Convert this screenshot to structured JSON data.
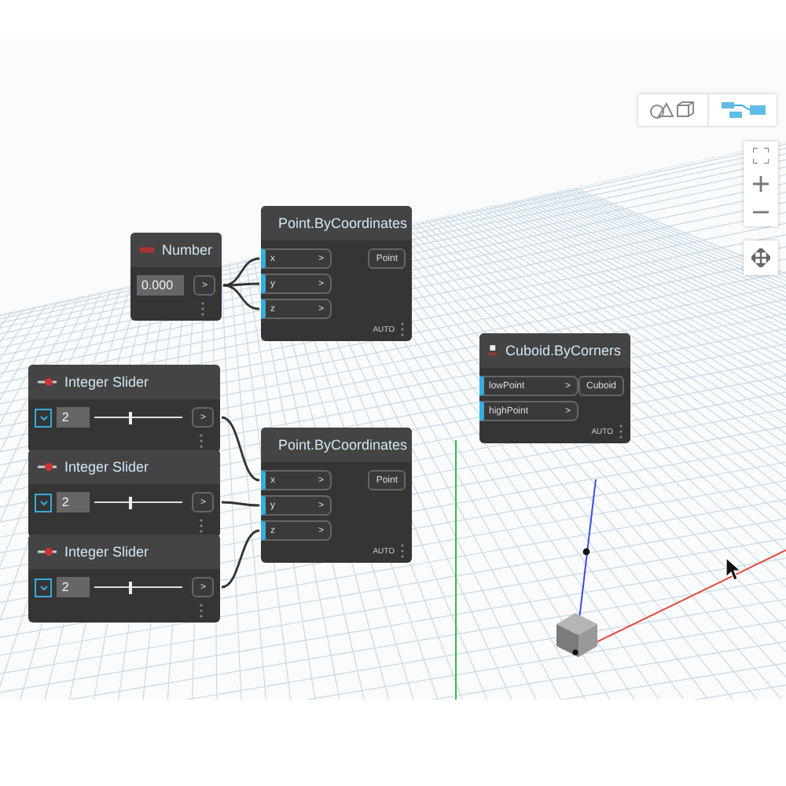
{
  "view_toggle": [
    {
      "kind": "geometry",
      "selected": false
    },
    {
      "kind": "graph",
      "selected": true
    }
  ],
  "nodes": [
    {
      "kind": "number",
      "title": "Number",
      "value": "0.000",
      "output": ">"
    },
    {
      "kind": "function",
      "title": "Point.ByCoordinates",
      "inputs": [
        "x",
        "y",
        "z"
      ],
      "port_arrow": ">",
      "output": "Point",
      "lacing": "AUTO"
    },
    {
      "kind": "slider",
      "title": "Integer Slider",
      "value": "2",
      "level": 0.4,
      "output": ">"
    },
    {
      "kind": "slider",
      "title": "Integer Slider",
      "value": "2",
      "level": 0.4,
      "output": ">"
    },
    {
      "kind": "slider",
      "title": "Integer Slider",
      "value": "2",
      "level": 0.4,
      "output": ">"
    },
    {
      "kind": "function",
      "title": "Point.ByCoordinates",
      "inputs": [
        "x",
        "y",
        "z"
      ],
      "port_arrow": ">",
      "output": "Point",
      "lacing": "AUTO"
    },
    {
      "kind": "function",
      "title": "Cuboid.ByCorners",
      "inputs": [
        "lowPoint",
        "highPoint"
      ],
      "port_arrow": ">",
      "output": "Cuboid",
      "lacing": "AUTO"
    }
  ]
}
